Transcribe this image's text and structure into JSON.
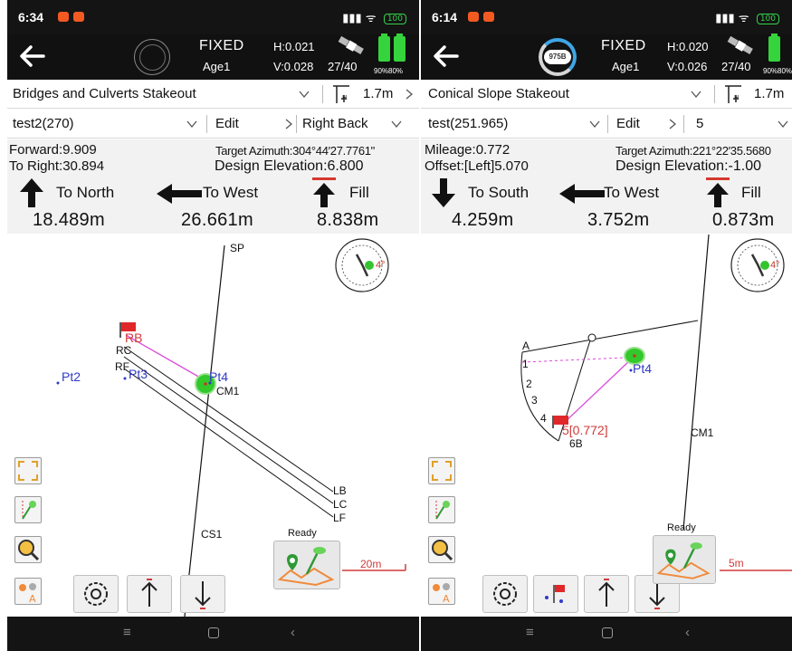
{
  "screen1": {
    "status_time": "6:34",
    "fix_status": "FIXED",
    "age": "Age1",
    "h_precision": "H:0.021",
    "v_precision": "V:0.028",
    "satellites": "27/40",
    "battery_pct": "90%80%",
    "status_battery": "100",
    "stakeout_mode": "Bridges and Culverts Stakeout",
    "antenna_height": "1.7m",
    "file": "test2(270)",
    "edit_label": "Edit",
    "side": "Right Back",
    "forward": "Forward:9.909",
    "to_right": "To Right:30.894",
    "target_azimuth": "Target Azimuth:304°44′27.7761\"",
    "design_elevation": "Design Elevation:6.800",
    "dir1_label": "To North",
    "dir1_value": "18.489m",
    "dir2_label": "To West",
    "dir2_value": "26.661m",
    "dir3_label": "Fill",
    "dir3_value": "8.838m",
    "map_labels": {
      "sp": "SP",
      "rb": "RB",
      "rc": "RC",
      "rf": "RF",
      "pt2": "Pt2",
      "pt3": "Pt3",
      "pt4": "Pt4",
      "cm1": "CM1",
      "lb": "LB",
      "lc": "LC",
      "lf": "LF",
      "cs1": "CS1",
      "compass_deg": "4°"
    },
    "ready": "Ready",
    "scale": "20m"
  },
  "screen2": {
    "status_time": "6:14",
    "fix_status": "FIXED",
    "age": "Age1",
    "ring_label": "975B",
    "h_precision": "H:0.020",
    "v_precision": "V:0.026",
    "satellites": "27/40",
    "battery_pct": "90%80%",
    "status_battery": "100",
    "stakeout_mode": "Conical Slope Stakeout",
    "antenna_height": "1.7m",
    "file": "test(251.965)",
    "edit_label": "Edit",
    "side": "5",
    "mileage": "Mileage:0.772",
    "offset": "Offset:[Left]5.070",
    "target_azimuth": "Target Azimuth:221°22′35.5680",
    "design_elevation": "Design Elevation:-1.00",
    "dir1_label": "To South",
    "dir1_value": "4.259m",
    "dir2_label": "To West",
    "dir2_value": "3.752m",
    "dir3_label": "Fill",
    "dir3_value": "0.873m",
    "map_labels": {
      "a": "A",
      "o": "O",
      "n1": "1",
      "n2": "2",
      "n3": "3",
      "n4": "4",
      "n5": "5[0.772]",
      "n6b": "6B",
      "pt4": "Pt4",
      "cm1": "CM1",
      "compass_deg": "4°"
    },
    "ready": "Ready",
    "scale": "5m"
  },
  "colors": {
    "accent_green": "#35d43c",
    "point_blue": "#2f3ac7",
    "flag_red": "#e0282a",
    "guide_magenta": "#d94cd9"
  }
}
